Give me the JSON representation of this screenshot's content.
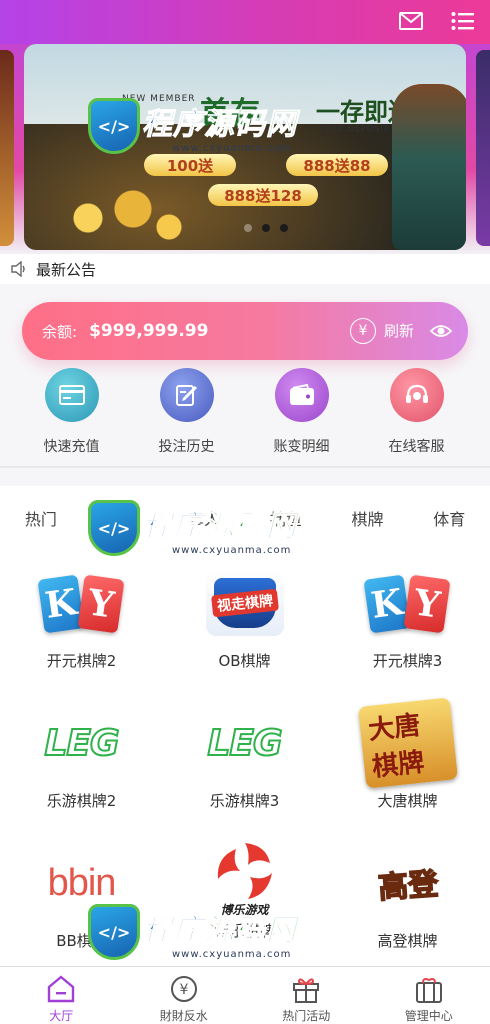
{
  "header": {
    "mail_icon": "mail-icon",
    "menu_icon": "menu-list-icon"
  },
  "banner": {
    "new_member": "NEW MEMBER",
    "headline": "首存",
    "subline": "一存即送",
    "deposit_bonus": "FREE DEPOSIT BONUS",
    "pill_1": "100送",
    "pill_2": "888送88",
    "pill_3": "888送128",
    "slides": 3,
    "active_slide": 1
  },
  "notice": {
    "icon": "speaker-icon",
    "text": "最新公告"
  },
  "balance": {
    "label": "余额:",
    "amount": "$999,999.99",
    "refresh": "刷新"
  },
  "quick_actions": [
    {
      "label": "快速充值",
      "icon": "card-icon",
      "color": "#3fb0c8"
    },
    {
      "label": "投注历史",
      "icon": "edit-icon",
      "color": "#5c6fcf"
    },
    {
      "label": "账变明细",
      "icon": "wallet-icon",
      "color": "#b158d8"
    },
    {
      "label": "在线客服",
      "icon": "headset-icon",
      "color": "#ef6b7e"
    }
  ],
  "tabs": [
    "热门",
    "电子",
    "真人",
    "捕鱼",
    "棋牌",
    "体育"
  ],
  "games": [
    {
      "name": "开元棋牌2",
      "logo": "ky-logo"
    },
    {
      "name": "OB棋牌",
      "logo": "ob-logo",
      "logo_text": "视走棋牌"
    },
    {
      "name": "开元棋牌3",
      "logo": "ky-logo"
    },
    {
      "name": "乐游棋牌2",
      "logo": "leg-logo",
      "logo_text": "LEG"
    },
    {
      "name": "乐游棋牌3",
      "logo": "leg-logo",
      "logo_text": "LEG"
    },
    {
      "name": "大唐棋牌",
      "logo": "datang-logo",
      "logo_text": "大唐棋牌"
    },
    {
      "name": "BB棋牌",
      "logo": "bbin-logo",
      "logo_text": "bbin"
    },
    {
      "name": "博乐棋牌",
      "logo": "bole-logo",
      "logo_text": "博乐游戏"
    },
    {
      "name": "高登棋牌",
      "logo": "gaodeng-logo",
      "logo_text": "高登"
    }
  ],
  "bottom_nav": [
    {
      "label": "大厅",
      "icon": "home-icon",
      "active": true
    },
    {
      "label": "財財反水",
      "icon": "yen-icon",
      "active": false
    },
    {
      "label": "热门活动",
      "icon": "gift-icon",
      "active": false
    },
    {
      "label": "管理中心",
      "icon": "gift-box-icon",
      "active": false
    }
  ],
  "watermark": {
    "title_a": "程序",
    "title_b": "源码网",
    "url": "www.cxyuanma.com"
  },
  "colors": {
    "header_start": "#b443e8",
    "header_end": "#ec3a97",
    "balance_start": "#ff6f86",
    "balance_end": "#d98ae6",
    "active_nav": "#a23fd6"
  }
}
